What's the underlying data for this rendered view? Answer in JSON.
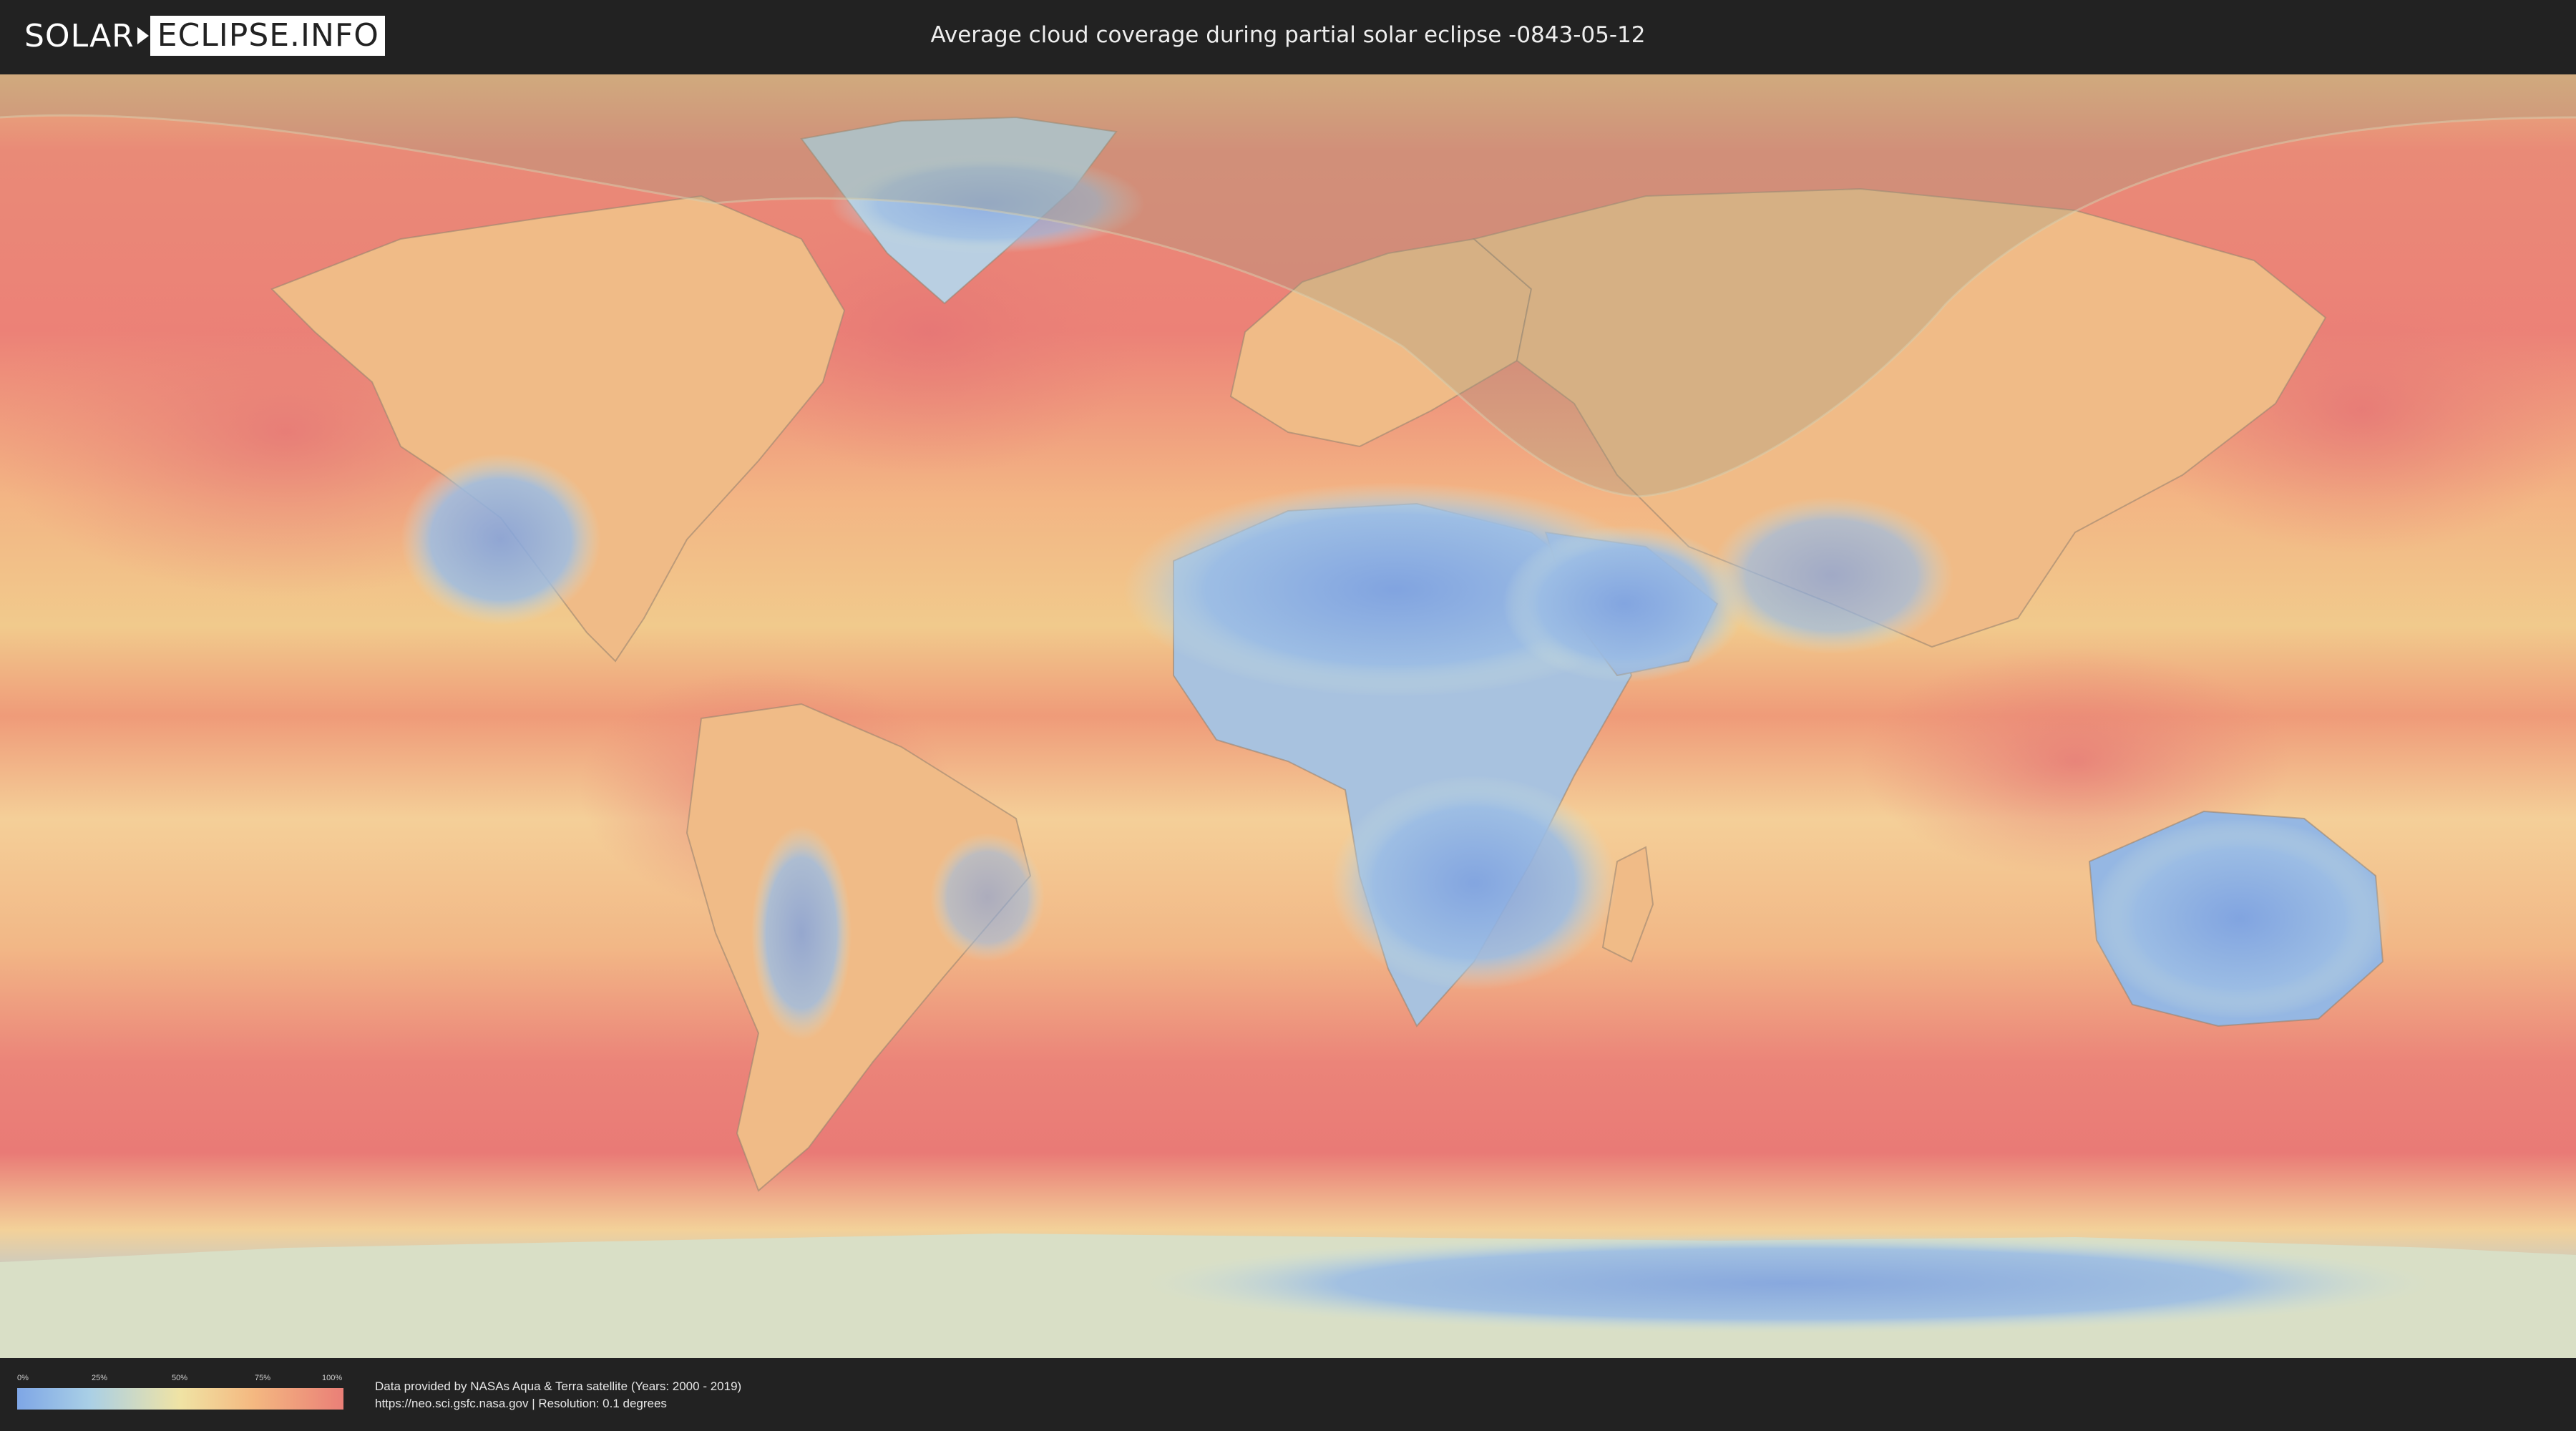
{
  "header": {
    "logo_left": "SOLAR",
    "logo_right": "ECLIPSE.INFO",
    "title": "Average cloud coverage during partial solar eclipse -0843-05-12"
  },
  "legend": {
    "ticks": [
      "0%",
      "25%",
      "50%",
      "75%",
      "100%"
    ],
    "colors": [
      "#7ea6e6",
      "#a9cfe6",
      "#f0e3a4",
      "#f4b981",
      "#ea7f77"
    ]
  },
  "footer": {
    "credit_line1": "Data provided by NASAs Aqua & Terra satellite (Years: 2000 - 2019)",
    "credit_line2": "https://neo.sci.gsfc.nasa.gov | Resolution: 0.1 degrees"
  },
  "map": {
    "projection": "equirectangular",
    "eclipse_overlay": "partial eclipse visibility region over northern hemisphere"
  }
}
